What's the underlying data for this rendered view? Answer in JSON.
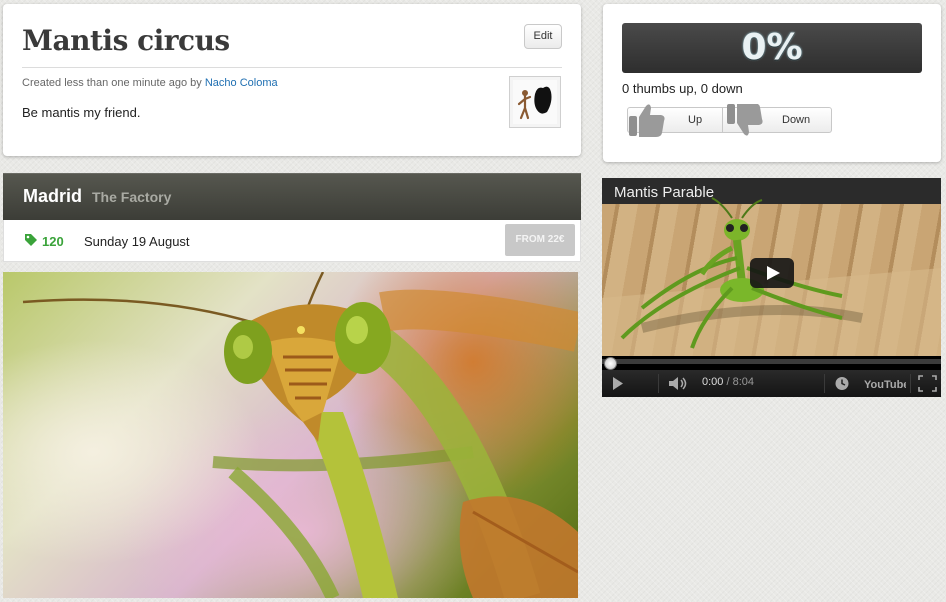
{
  "event": {
    "title": "Mantis circus",
    "edit_label": "Edit",
    "created_prefix": "Created less than one minute ago by",
    "author": "Nacho Coloma",
    "description": "Be mantis my friend."
  },
  "venue": {
    "city": "Madrid",
    "name": "The Factory"
  },
  "info": {
    "count": "120",
    "date": "Sunday 19 August",
    "price_label": "FROM 22€"
  },
  "vote": {
    "percent": "0%",
    "summary": "0 thumbs up, 0 down",
    "up_label": "Up",
    "down_label": "Down"
  },
  "video": {
    "title": "Mantis Parable",
    "time_current": "0:00",
    "time_sep": " / ",
    "time_total": "8:04",
    "brand": "YouTube",
    "progress_fraction": 0
  },
  "colors": {
    "link": "#1f6fb2",
    "count_green": "#3aa33a",
    "venue_bar": "#45463f"
  },
  "icons": [
    "tag-icon",
    "thumbs-up-icon",
    "thumbs-down-icon",
    "play-icon",
    "volume-icon",
    "clock-icon",
    "youtube-logo-icon",
    "fullscreen-icon"
  ]
}
